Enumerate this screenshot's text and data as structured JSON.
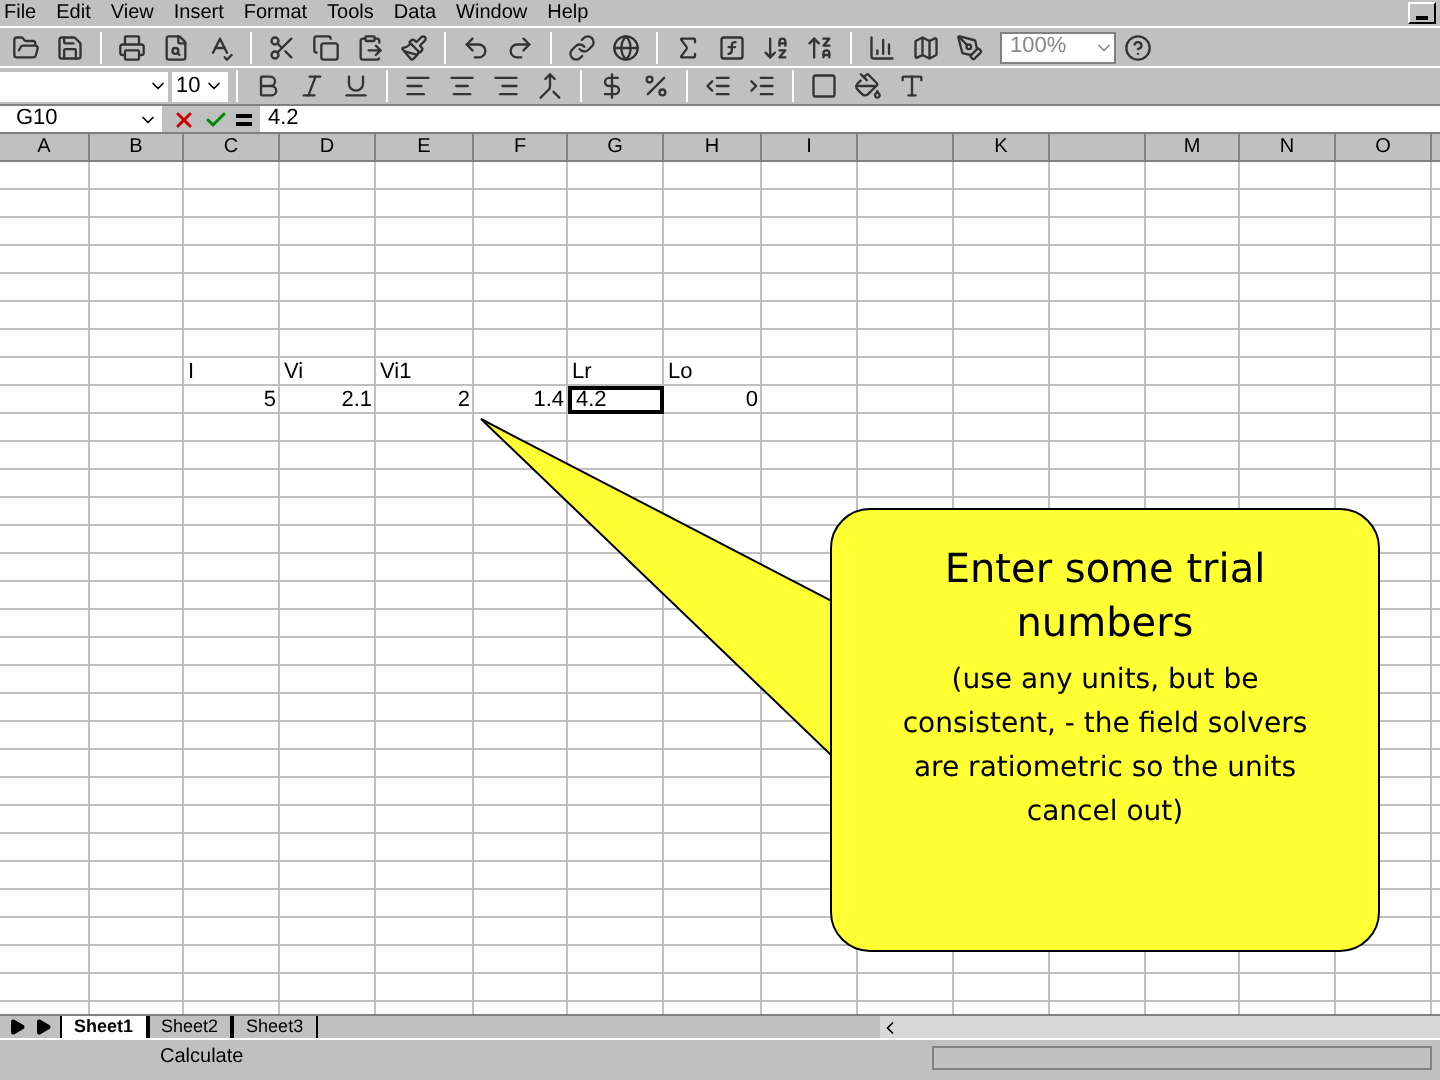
{
  "menu": [
    "File",
    "Edit",
    "View",
    "Insert",
    "Format",
    "Tools",
    "Data",
    "Window",
    "Help"
  ],
  "zoom": "100%",
  "font_size": "10",
  "name_box": "G10",
  "formula": "4.2",
  "column_headers": [
    {
      "label": "A"
    },
    {
      "label": "B"
    },
    {
      "label": "C"
    },
    {
      "label": "D"
    },
    {
      "label": "E"
    },
    {
      "label": "F"
    },
    {
      "label": "G"
    },
    {
      "label": "H"
    },
    {
      "label": "I"
    },
    {
      "label": "K",
      "gap_before": true
    },
    {
      "label": "M",
      "gap_before": true
    },
    {
      "label": "N"
    },
    {
      "label": "O"
    }
  ],
  "rows": [
    {
      "kind": "label",
      "cells": [
        null,
        null,
        {
          "text": "I",
          "selected": false
        },
        {
          "text": "Vi",
          "selected": false
        },
        {
          "text": "Vi1",
          "selected": false
        },
        null,
        {
          "text": "Lr",
          "selected": false
        },
        {
          "text": "Lo",
          "selected": false
        }
      ]
    },
    {
      "kind": "value",
      "cells": [
        null,
        null,
        {
          "text": "5",
          "selected": false
        },
        {
          "text": "2.1",
          "selected": false
        },
        {
          "text": "2",
          "selected": false
        },
        {
          "text": "1.4",
          "selected": false
        },
        {
          "text": "4.2",
          "selected": true
        },
        {
          "text": "0",
          "selected": false
        }
      ]
    }
  ],
  "callout": {
    "title": "Enter some trial numbers",
    "body": "(use any units, but be consistent, - the field solvers are ratiometric so the units cancel out)"
  },
  "sheet_tabs": [
    {
      "label": "Sheet1",
      "selected": true
    },
    {
      "label": "Sheet2",
      "selected": false
    },
    {
      "label": "Sheet3",
      "selected": false
    }
  ],
  "status": "Calculate"
}
